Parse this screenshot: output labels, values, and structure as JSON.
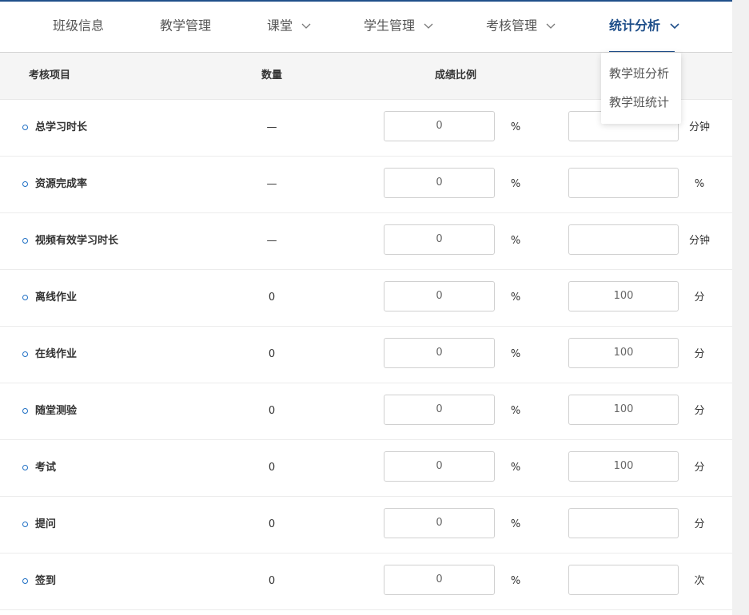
{
  "nav": {
    "items": [
      {
        "label": "班级信息",
        "has_menu": false
      },
      {
        "label": "教学管理",
        "has_menu": false
      },
      {
        "label": "课堂",
        "has_menu": true
      },
      {
        "label": "学生管理",
        "has_menu": true
      },
      {
        "label": "考核管理",
        "has_menu": true
      },
      {
        "label": "统计分析",
        "has_menu": true,
        "active": true
      }
    ],
    "dropdown": [
      "教学班分析",
      "教学班统计"
    ]
  },
  "table": {
    "headers": {
      "item": "考核项目",
      "count": "数量",
      "ratio": "成绩比例"
    },
    "rows": [
      {
        "name": "总学习时长",
        "count": "—",
        "ratio": "0",
        "pct": "%",
        "target": "",
        "unit": "分钟"
      },
      {
        "name": "资源完成率",
        "count": "—",
        "ratio": "0",
        "pct": "%",
        "target": "",
        "unit": "%"
      },
      {
        "name": "视频有效学习时长",
        "count": "—",
        "ratio": "0",
        "pct": "%",
        "target": "",
        "unit": "分钟"
      },
      {
        "name": "离线作业",
        "count": "0",
        "ratio": "0",
        "pct": "%",
        "target": "100",
        "unit": "分"
      },
      {
        "name": "在线作业",
        "count": "0",
        "ratio": "0",
        "pct": "%",
        "target": "100",
        "unit": "分"
      },
      {
        "name": "随堂测验",
        "count": "0",
        "ratio": "0",
        "pct": "%",
        "target": "100",
        "unit": "分"
      },
      {
        "name": "考试",
        "count": "0",
        "ratio": "0",
        "pct": "%",
        "target": "100",
        "unit": "分"
      },
      {
        "name": "提问",
        "count": "0",
        "ratio": "0",
        "pct": "%",
        "target": "",
        "unit": "分"
      },
      {
        "name": "签到",
        "count": "0",
        "ratio": "0",
        "pct": "%",
        "target": "",
        "unit": "次"
      }
    ]
  },
  "colors": {
    "accent": "#1f4f8a",
    "dot": "#1f6fc4"
  }
}
